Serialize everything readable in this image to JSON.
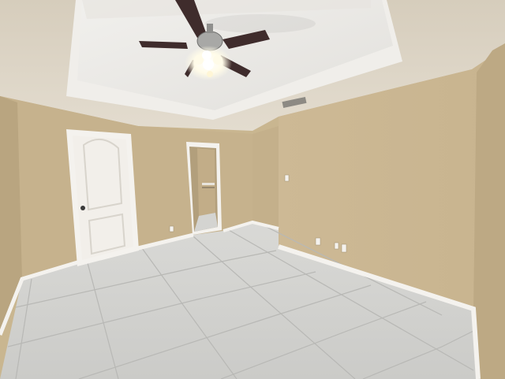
{
  "scene": {
    "kind": "photo",
    "room": "empty bedroom",
    "elements": [
      "tray-ceiling",
      "ceiling-fan",
      "ceiling-vent",
      "door",
      "doorway",
      "closet",
      "tile-floor",
      "baseboards",
      "outlets",
      "light-switch"
    ]
  },
  "colors": {
    "ceiling": "#ece9e4",
    "ceiling_shadow": "#d8d4cd",
    "wall_left": "#c6b28d",
    "wall_back": "#cdb995",
    "wall_right": "#d2bf9b",
    "wall_right_edge": "#bda984",
    "door": "#f2efea",
    "trim": "#f4f2ee",
    "floor": "#cfcfcc",
    "grout": "#b9b9b6",
    "fan_blade": "#3f2c2c",
    "fan_light": "#fffbe8"
  }
}
